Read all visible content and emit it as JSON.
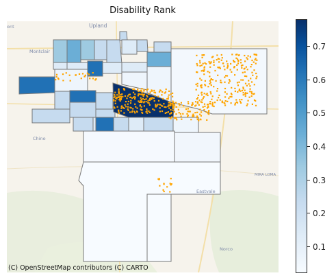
{
  "title": "Disability Rank",
  "attribution": "(C) OpenStreetMap contributors (C) CARTO",
  "basemap_labels": {
    "upland": "Upland",
    "montclair": "Montclair",
    "chino": "Chino",
    "eastvale": "Eastvale",
    "norco": "Norco",
    "mira_loma": "MIRA LOMA",
    "ont": "ont"
  },
  "colorbar": {
    "colormap": "Blues",
    "min": 0.02,
    "max": 0.78,
    "ticks": [
      "0.1",
      "0.2",
      "0.3",
      "0.4",
      "0.5",
      "0.6",
      "0.7"
    ]
  },
  "colors": {
    "point": "#ffa500",
    "tract_border": "#777777",
    "basemap": "#f6f3ec"
  }
}
